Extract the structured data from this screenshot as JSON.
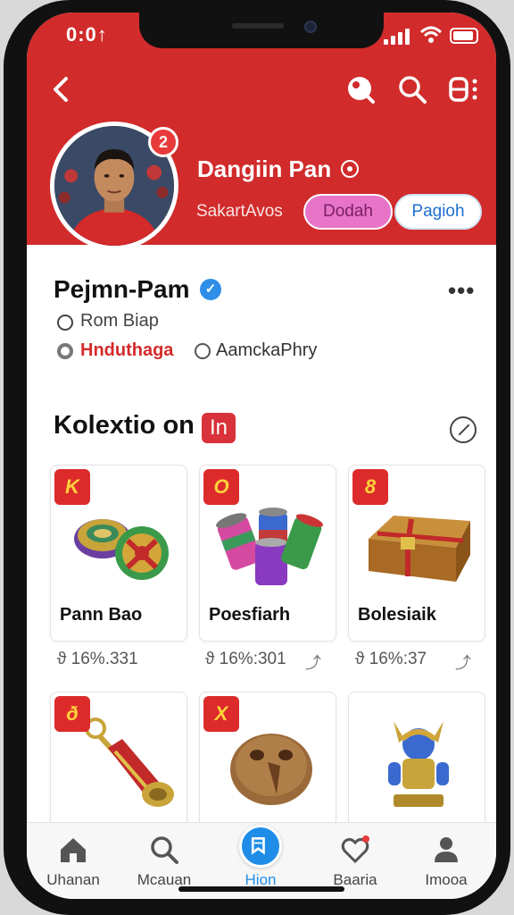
{
  "status_bar": {
    "time": "0:0↑"
  },
  "header": {
    "name": "Dangiin Pan",
    "subtitle": "SakartAvos",
    "notification_count": "2",
    "button_primary": "Dodah",
    "button_secondary": "Pagioh"
  },
  "profile": {
    "name": "Pejmn-Pam",
    "location": "Rom Biap",
    "tag_primary": "Hnduthaga",
    "tag_secondary": "AamckaPhry",
    "more": "•••"
  },
  "section": {
    "title": "Kolextio on",
    "badge": "In"
  },
  "collection": [
    {
      "badge": "K",
      "label": "Pann Bao",
      "price": "ϑ 16%.331",
      "art": "medallion-icon"
    },
    {
      "badge": "O",
      "label": "Poesfiarh",
      "price": "ϑ 16%:301",
      "art": "cans-icon"
    },
    {
      "badge": "8",
      "label": "Bolesiaik",
      "price": "ϑ 16%:37",
      "art": "chest-icon"
    },
    {
      "badge": "ð",
      "label": "",
      "price": "",
      "art": "horn-icon"
    },
    {
      "badge": "X",
      "label": "",
      "price": "",
      "art": "mask-icon"
    },
    {
      "badge": "",
      "label": "",
      "price": "",
      "art": "figurine-icon"
    }
  ],
  "bottom_nav": [
    {
      "label": "Uhanan",
      "icon": "home-icon"
    },
    {
      "label": "Mcauan",
      "icon": "search-icon"
    },
    {
      "label": "Hion",
      "icon": "center-icon",
      "active": true
    },
    {
      "label": "Baaria",
      "icon": "heart-icon"
    },
    {
      "label": "Imooa",
      "icon": "person-icon"
    }
  ],
  "colors": {
    "header_red": "#d12b2b",
    "accent_blue": "#1f8de8",
    "pink_button": "#e874c8",
    "badge_red": "#dd2b2b"
  }
}
